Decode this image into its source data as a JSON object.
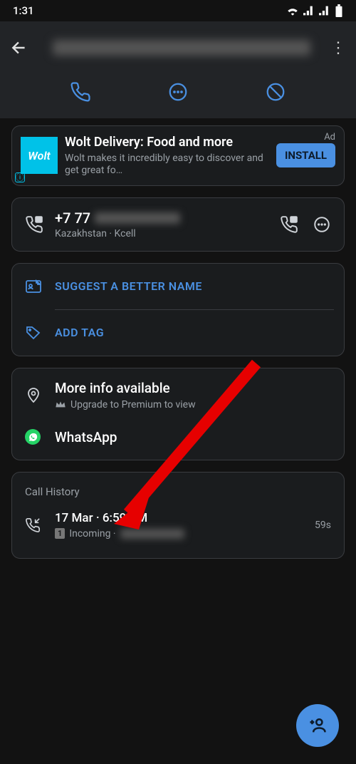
{
  "status": {
    "time": "1:31"
  },
  "ad": {
    "logo_text": "Wolt",
    "title": "Wolt Delivery: Food and more",
    "desc": "Wolt makes it incredibly easy to discover and get great fo…",
    "badge": "Ad",
    "install": "INSTALL"
  },
  "phone": {
    "prefix": "+7 77",
    "sub": "Kazakhstan · Kcell"
  },
  "suggest_label": "SUGGEST A BETTER NAME",
  "add_tag_label": "ADD TAG",
  "info": {
    "title": "More info available",
    "sub": "Upgrade to Premium to view"
  },
  "whatsapp_label": "WhatsApp",
  "history": {
    "title": "Call History",
    "call_time": "17 Mar · 6:59 PM",
    "call_type": "Incoming ·",
    "duration": "59s"
  }
}
